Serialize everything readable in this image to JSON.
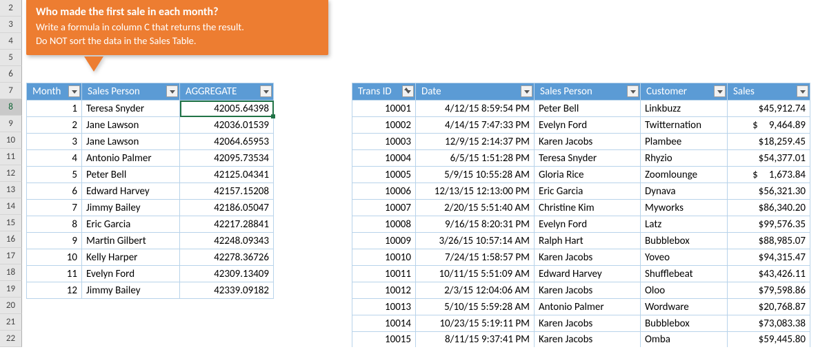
{
  "rowHeaders": [
    "2",
    "3",
    "4",
    "5",
    "6",
    "7",
    "8",
    "9",
    "10",
    "11",
    "12",
    "13",
    "14",
    "15",
    "16",
    "17",
    "18",
    "19",
    "20",
    "21",
    "22"
  ],
  "selectedRow": "8",
  "callout": {
    "title": "Who made the first sale in each month?",
    "line1": "Write a formula in column C that returns the result.",
    "line2": "Do NOT sort the data in the Sales Table."
  },
  "leftTable": {
    "headers": [
      "Month",
      "Sales Person",
      "AGGREGATE"
    ],
    "rows": [
      {
        "month": "1",
        "person": "Teresa Snyder",
        "agg": "42005.64398"
      },
      {
        "month": "2",
        "person": "Jane Lawson",
        "agg": "42036.01539"
      },
      {
        "month": "3",
        "person": "Jane Lawson",
        "agg": "42064.65953"
      },
      {
        "month": "4",
        "person": "Antonio Palmer",
        "agg": "42095.73534"
      },
      {
        "month": "5",
        "person": "Peter Bell",
        "agg": "42125.04341"
      },
      {
        "month": "6",
        "person": "Edward Harvey",
        "agg": "42157.15208"
      },
      {
        "month": "7",
        "person": "Jimmy Bailey",
        "agg": "42186.05047"
      },
      {
        "month": "8",
        "person": "Eric Garcia",
        "agg": "42217.28841"
      },
      {
        "month": "9",
        "person": "Martin Gilbert",
        "agg": "42248.09343"
      },
      {
        "month": "10",
        "person": "Kelly Harper",
        "agg": "42278.36726"
      },
      {
        "month": "11",
        "person": "Evelyn Ford",
        "agg": "42309.13409"
      },
      {
        "month": "12",
        "person": "Jimmy Bailey",
        "agg": "42339.09182"
      }
    ]
  },
  "rightTable": {
    "headers": [
      "Trans ID",
      "Date",
      "Sales Person",
      "Customer",
      "Sales"
    ],
    "rows": [
      {
        "id": "10001",
        "date": "4/12/15 8:59:54 PM",
        "person": "Peter Bell",
        "cust": "Linkbuzz",
        "sales": "$45,912.74"
      },
      {
        "id": "10002",
        "date": "4/14/15 7:47:33 PM",
        "person": "Evelyn Ford",
        "cust": "Twitternation",
        "sales": "$  9,464.89"
      },
      {
        "id": "10003",
        "date": "12/9/15 2:14:37 PM",
        "person": "Karen Jacobs",
        "cust": "Plambee",
        "sales": "$18,259.45"
      },
      {
        "id": "10004",
        "date": "6/5/15 1:51:28 PM",
        "person": "Teresa Snyder",
        "cust": "Rhyzio",
        "sales": "$54,377.01"
      },
      {
        "id": "10005",
        "date": "5/9/15 10:55:28 AM",
        "person": "Gloria Rice",
        "cust": "Zoomlounge",
        "sales": "$  1,673.84"
      },
      {
        "id": "10006",
        "date": "12/13/15 12:13:00 PM",
        "person": "Eric Garcia",
        "cust": "Dynava",
        "sales": "$56,321.30"
      },
      {
        "id": "10007",
        "date": "2/20/15 5:51:40 AM",
        "person": "Christine Kim",
        "cust": "Myworks",
        "sales": "$86,340.20"
      },
      {
        "id": "10008",
        "date": "9/16/15 8:20:31 PM",
        "person": "Evelyn Ford",
        "cust": "Latz",
        "sales": "$99,576.35"
      },
      {
        "id": "10009",
        "date": "3/26/15 10:57:14 AM",
        "person": "Ralph Hart",
        "cust": "Bubblebox",
        "sales": "$88,985.07"
      },
      {
        "id": "10010",
        "date": "7/24/15 1:58:57 PM",
        "person": "Karen Jacobs",
        "cust": "Yoveo",
        "sales": "$94,315.47"
      },
      {
        "id": "10011",
        "date": "10/11/15 5:51:09 AM",
        "person": "Edward Harvey",
        "cust": "Shufflebeat",
        "sales": "$43,426.11"
      },
      {
        "id": "10012",
        "date": "2/3/15 12:04:06 AM",
        "person": "Karen Jacobs",
        "cust": "Oloo",
        "sales": "$79,598.86"
      },
      {
        "id": "10013",
        "date": "5/10/15 5:59:28 AM",
        "person": "Antonio Palmer",
        "cust": "Wordware",
        "sales": "$20,768.87"
      },
      {
        "id": "10014",
        "date": "10/23/15 5:19:11 PM",
        "person": "Karen Jacobs",
        "cust": "Bubblebox",
        "sales": "$73,083.38"
      },
      {
        "id": "10015",
        "date": "8/11/15 9:37:41 PM",
        "person": "Karen Jacobs",
        "cust": "Omba",
        "sales": "$59,445.80"
      }
    ]
  }
}
